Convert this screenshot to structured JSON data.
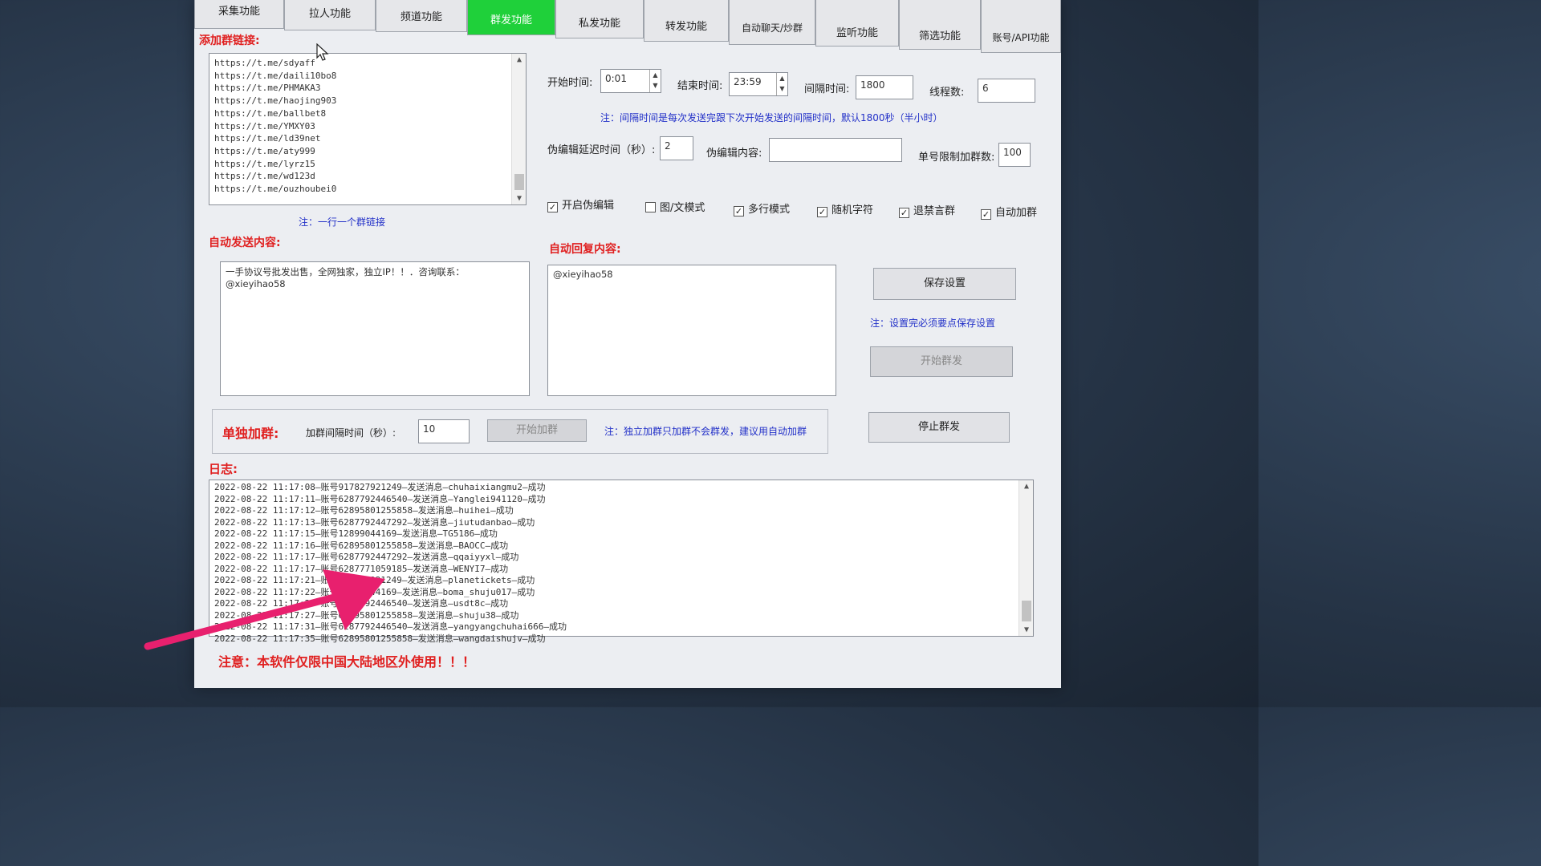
{
  "window": {
    "controls": {
      "minimize": "—",
      "maximize": "☐",
      "close": "✕"
    }
  },
  "tabs": [
    {
      "label": "采集功能",
      "active": false
    },
    {
      "label": "拉人功能",
      "active": false
    },
    {
      "label": "频道功能",
      "active": false
    },
    {
      "label": "群发功能",
      "active": true
    },
    {
      "label": "私发功能",
      "active": false
    },
    {
      "label": "转发功能",
      "active": false
    },
    {
      "label": "自动聊天/炒群",
      "active": false
    },
    {
      "label": "监听功能",
      "active": false
    },
    {
      "label": "筛选功能",
      "active": false
    },
    {
      "label": "账号/API功能",
      "active": false
    }
  ],
  "group_links": {
    "label": "添加群链接:",
    "links": [
      "https://t.me/sdyaff",
      "https://t.me/daili10bo8",
      "https://t.me/PHMAKA3",
      "https://t.me/haojing903",
      "https://t.me/ballbet8",
      "https://t.me/YMXY03",
      "https://t.me/ld39net",
      "https://t.me/aty999",
      "https://t.me/lyrz15",
      "https://t.me/wd123d",
      "https://t.me/ouzhoubei0"
    ],
    "note": "注：一行一个群链接"
  },
  "settings": {
    "start_time_label": "开始时间:",
    "start_time": "0:01",
    "end_time_label": "结束时间:",
    "end_time": "23:59",
    "interval_label": "间隔时间:",
    "interval": "1800",
    "threads_label": "线程数:",
    "threads": "6",
    "interval_note": "注：间隔时间是每次发送完跟下次开始发送的间隔时间，默认1800秒（半小时）",
    "fake_edit_delay_label": "伪编辑延迟时间（秒）:",
    "fake_edit_delay": "2",
    "fake_edit_content_label": "伪编辑内容:",
    "fake_edit_content": "",
    "join_limit_label": "单号限制加群数:",
    "join_limit": "100"
  },
  "options": [
    {
      "label": "开启伪编辑",
      "checked": true
    },
    {
      "label": "图/文模式",
      "checked": false
    },
    {
      "label": "多行模式",
      "checked": true
    },
    {
      "label": "随机字符",
      "checked": true
    },
    {
      "label": "退禁言群",
      "checked": true
    },
    {
      "label": "自动加群",
      "checked": true
    }
  ],
  "auto_send": {
    "label": "自动发送内容:",
    "content_line1": "一手协议号批发出售，全网独家，独立IP！！．咨询联系：",
    "content_line2": "@xieyihao58"
  },
  "auto_reply": {
    "label": "自动回复内容:",
    "content": "@xieyihao58"
  },
  "actions": {
    "save": "保存设置",
    "save_note": "注：设置完必须要点保存设置",
    "start_broadcast": "开始群发",
    "stop_broadcast": "停止群发"
  },
  "single_join": {
    "title": "单独加群:",
    "interval_label": "加群间隔时间（秒）:",
    "interval": "10",
    "start_button": "开始加群",
    "note": "注：独立加群只加群不会群发，建议用自动加群"
  },
  "log": {
    "label": "日志:",
    "lines": [
      "2022-08-22 11:17:08—账号917827921249—发送消息—chuhaixiangmu2—成功",
      "2022-08-22 11:17:11—账号6287792446540—发送消息—Yanglei941120—成功",
      "2022-08-22 11:17:12—账号62895801255858—发送消息—huihei—成功",
      "2022-08-22 11:17:13—账号6287792447292—发送消息—jiutudanbao—成功",
      "2022-08-22 11:17:15—账号12899044169—发送消息—TG5186—成功",
      "2022-08-22 11:17:16—账号62895801255858—发送消息—BAOCC—成功",
      "2022-08-22 11:17:17—账号6287792447292—发送消息—qqaiyyxl—成功",
      "2022-08-22 11:17:17—账号6287771059185—发送消息—WENYI7—成功",
      "2022-08-22 11:17:21—账号917827921249—发送消息—planetickets—成功",
      "2022-08-22 11:17:22—账号12899044169—发送消息—boma_shuju017—成功",
      "2022-08-22 11:17:22—账号6287792446540—发送消息—usdt8c—成功",
      "2022-08-22 11:17:27—账号62895801255858—发送消息—shuju38—成功",
      "2022-08-22 11:17:31—账号6287792446540—发送消息—yangyangchuhai666—成功",
      "2022-08-22 11:17:35—账号62895801255858—发送消息—wangdaishujv—成功"
    ]
  },
  "footer_warning": "注意：本软件仅限中国大陆地区外使用！！！",
  "colors": {
    "active_tab": "#1fd03a",
    "label_red": "#e02020",
    "note_blue": "#2230c8",
    "titlebar": "#1f3fb0",
    "arrow_pink": "#e8206e"
  }
}
